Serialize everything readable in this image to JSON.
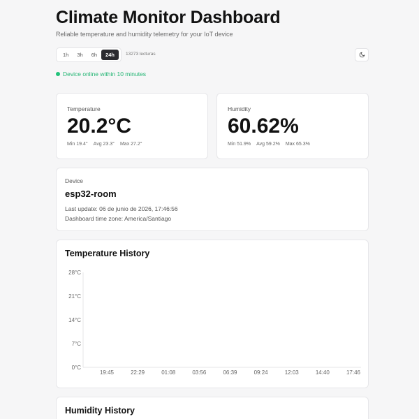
{
  "header": {
    "title": "Climate Monitor Dashboard",
    "subtitle": "Reliable temperature and humidity telemetry for your IoT device"
  },
  "toolbar": {
    "ranges": [
      {
        "label": "1h",
        "active": false
      },
      {
        "label": "3h",
        "active": false
      },
      {
        "label": "6h",
        "active": false
      },
      {
        "label": "24h",
        "active": true
      }
    ],
    "readings": "13273 lecturas",
    "theme_icon": "moon-icon"
  },
  "status": {
    "text": "Device online within 10 minutes",
    "color": "#22c27a"
  },
  "temperature": {
    "label": "Temperature",
    "value": "20.2°C",
    "min": "Min 19.4°",
    "avg": "Avg 23.3°",
    "max": "Max 27.2°"
  },
  "humidity": {
    "label": "Humidity",
    "value": "60.62%",
    "min": "Min 51.9%",
    "avg": "Avg 59.2%",
    "max": "Max 65.3%"
  },
  "device": {
    "label": "Device",
    "name": "esp32-room",
    "last_update": "Last update: 06 de junio de 2026, 17:46:56",
    "timezone": "Dashboard time zone: America/Santiago"
  },
  "temp_chart": {
    "title": "Temperature History"
  },
  "humidity_chart": {
    "title": "Humidity History"
  },
  "chart_data": {
    "type": "line",
    "title": "Temperature History",
    "xlabel": "",
    "ylabel": "",
    "x_ticks": [
      "19:45",
      "22:29",
      "01:08",
      "03:56",
      "06:39",
      "09:24",
      "12:03",
      "14:40",
      "17:46"
    ],
    "y_ticks": [
      "28°C",
      "21°C",
      "14°C",
      "7°C",
      "0°C"
    ],
    "ylim": [
      0,
      28
    ],
    "series": [],
    "grid": false
  }
}
